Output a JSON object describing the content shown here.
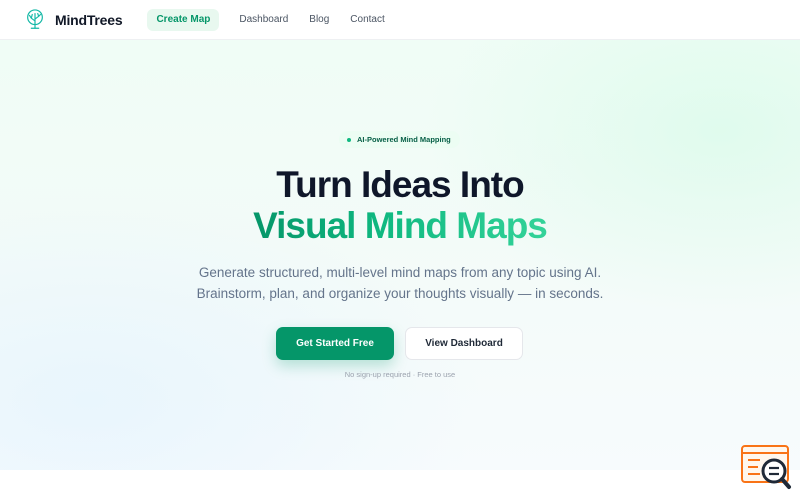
{
  "brand": {
    "name": "MindTrees",
    "logo_icon": "tree-icon"
  },
  "nav": {
    "create_map": "Create Map",
    "links": [
      "Dashboard",
      "Blog",
      "Contact"
    ]
  },
  "hero": {
    "badge": "AI-Powered Mind Mapping",
    "headline_line1": "Turn Ideas Into",
    "headline_line2": "Visual Mind Maps",
    "subtext_line1": "Generate structured, multi-level mind maps from any topic using AI.",
    "subtext_line2": "Brainstorm, plan, and organize your thoughts visually — in seconds.",
    "primary_cta": "Get Started Free",
    "secondary_cta": "View Dashboard",
    "note": "No sign-up required · Free to use"
  },
  "widget": {
    "icon": "search-help-icon"
  },
  "colors": {
    "accent": "#059669",
    "accent_light": "#10b981",
    "heading": "#0f172a",
    "muted": "#64748b",
    "widget": "#f97316"
  }
}
